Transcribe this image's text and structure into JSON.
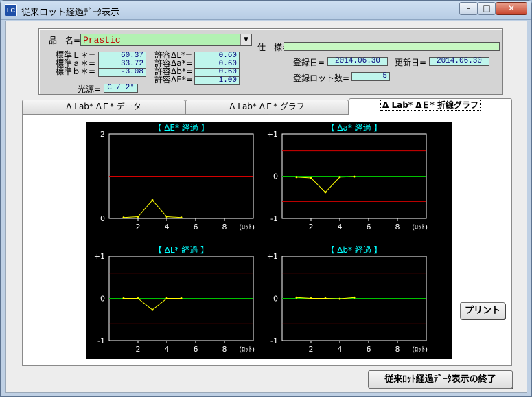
{
  "window": {
    "title": "従来ロット経過ﾃﾞｰﾀ表示",
    "icon_text": "LC",
    "minimize_icon": "minimize-icon",
    "maximize_icon": "maximize-icon",
    "close_icon": "close-icon"
  },
  "info": {
    "product_label": "品　名",
    "product_value": "Prastic",
    "spec_label": "仕　様",
    "spec_value": "",
    "std_L_label": "標準Ｌ＊",
    "std_L": "60.37",
    "std_a_label": "標準ａ＊",
    "std_a": "33.72",
    "std_b_label": "標準ｂ＊",
    "std_b": "-3.08",
    "tol_L_label": "許容ΔL*",
    "tol_L": "0.60",
    "tol_a_label": "許容Δa*",
    "tol_a": "0.60",
    "tol_b_label": "許容Δb*",
    "tol_b": "0.60",
    "tol_E_label": "許容ΔE*",
    "tol_E": "1.00",
    "light_label": "光源",
    "light_value": "C / 2°",
    "reg_date_label": "登録日",
    "reg_date": "2014.06.30",
    "upd_date_label": "更新日",
    "upd_date": "2014.06.30",
    "lot_count_label": "登録ロット数",
    "lot_count": "5"
  },
  "tabs": [
    {
      "label": "Δ Lab* ΔＥ* データ"
    },
    {
      "label": "Δ Lab* ΔＥ* グラフ"
    },
    {
      "label": "Δ Lab* ΔＥ* 折線グラフ"
    }
  ],
  "buttons": {
    "print": "プリント",
    "exit": "従来ﾛｯﾄ経過ﾃﾞｰﾀ表示の終了"
  },
  "colors": {
    "plot_bg": "#000000",
    "limit_line": "#d40000",
    "zero_line": "#00c000",
    "data_line": "#ffff00",
    "title_text": "#00ffff"
  },
  "chart_data": [
    {
      "type": "line",
      "title": "【 ΔE* 経過 】",
      "x": [
        1,
        2,
        3,
        4,
        5
      ],
      "series": [
        {
          "values": [
            0.02,
            0.04,
            0.43,
            0.04,
            0.02
          ]
        }
      ],
      "xlim": [
        0,
        10
      ],
      "ylim": [
        0,
        2
      ],
      "xticks": [
        "2",
        "4",
        "6",
        "8"
      ],
      "xunit": "(ﾛｯﾄ)",
      "yticks": [
        "2",
        "0"
      ],
      "limit_lines": [
        1.0
      ],
      "zero_line": false
    },
    {
      "type": "line",
      "title": "【 Δa* 経過 】",
      "x": [
        1,
        2,
        3,
        4,
        5
      ],
      "series": [
        {
          "values": [
            -0.02,
            -0.04,
            -0.38,
            -0.02,
            -0.01
          ]
        }
      ],
      "xlim": [
        0,
        10
      ],
      "ylim": [
        -1,
        1
      ],
      "xticks": [
        "2",
        "4",
        "6",
        "8"
      ],
      "xunit": "(ﾛｯﾄ)",
      "yticks": [
        "+1",
        "0",
        "-1"
      ],
      "limit_lines": [
        0.6,
        -0.6
      ],
      "zero_line": true
    },
    {
      "type": "line",
      "title": "【 ΔL* 経過 】",
      "x": [
        1,
        2,
        3,
        4,
        5
      ],
      "series": [
        {
          "values": [
            0.0,
            0.0,
            -0.27,
            0.0,
            0.0
          ]
        }
      ],
      "xlim": [
        0,
        10
      ],
      "ylim": [
        -1,
        1
      ],
      "xticks": [
        "2",
        "4",
        "6",
        "8"
      ],
      "xunit": "(ﾛｯﾄ)",
      "yticks": [
        "+1",
        "0",
        "-1"
      ],
      "limit_lines": [
        0.6,
        -0.6
      ],
      "zero_line": true
    },
    {
      "type": "line",
      "title": "【 Δb* 経過 】",
      "x": [
        1,
        2,
        3,
        4,
        5
      ],
      "series": [
        {
          "values": [
            0.02,
            0.0,
            0.0,
            -0.01,
            0.02
          ]
        }
      ],
      "xlim": [
        0,
        10
      ],
      "ylim": [
        -1,
        1
      ],
      "xticks": [
        "2",
        "4",
        "6",
        "8"
      ],
      "xunit": "(ﾛｯﾄ)",
      "yticks": [
        "+1",
        "0",
        "-1"
      ],
      "limit_lines": [
        0.6,
        -0.6
      ],
      "zero_line": true
    }
  ]
}
